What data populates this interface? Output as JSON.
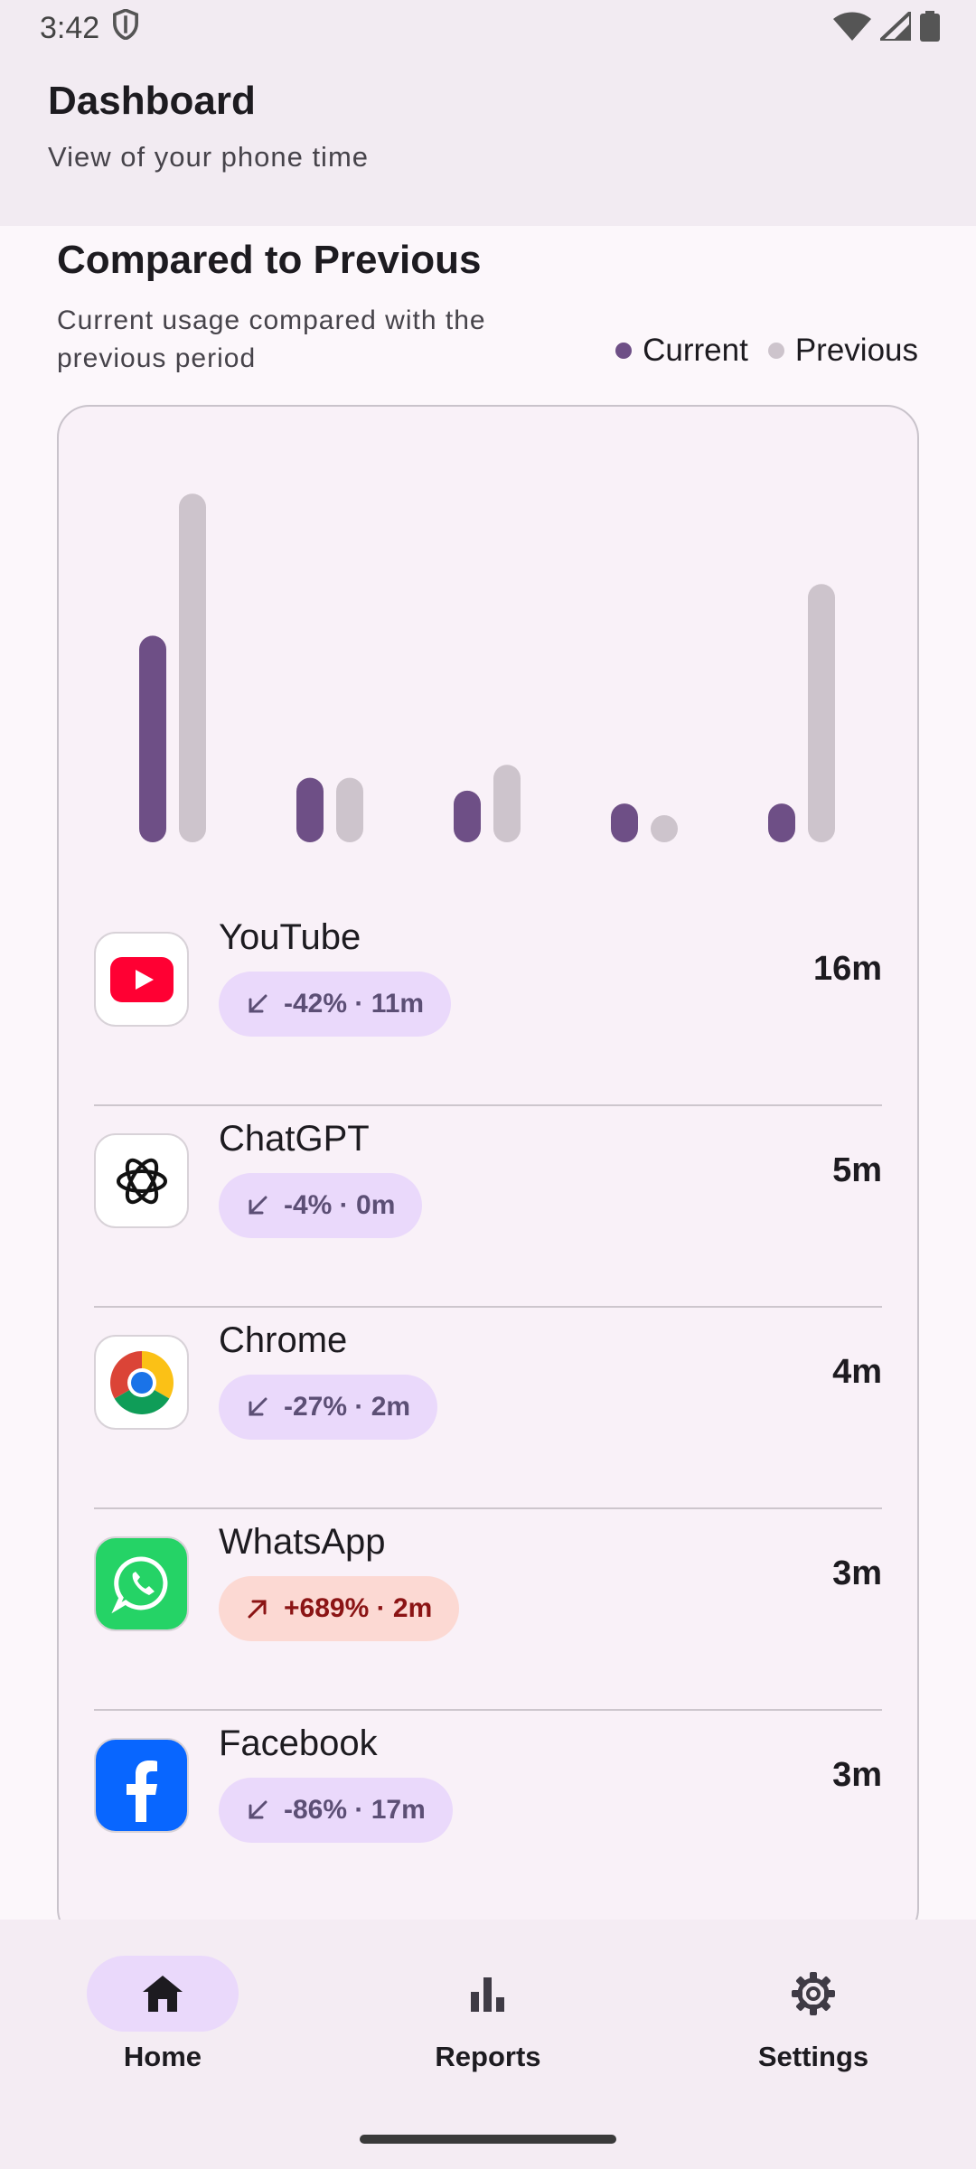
{
  "status_bar": {
    "time": "3:42",
    "icons": [
      "shield-icon",
      "wifi-icon",
      "signal-icon",
      "battery-icon"
    ]
  },
  "header": {
    "title": "Dashboard",
    "subtitle": "View of your phone time"
  },
  "section": {
    "title": "Compared to Previous",
    "description": "Current usage compared with the previous period",
    "legend": [
      {
        "label": "Current",
        "color": "#6e4f86"
      },
      {
        "label": "Previous",
        "color": "#cdc4cc"
      }
    ]
  },
  "chart_data": {
    "type": "bar",
    "categories": [
      "YouTube",
      "ChatGPT",
      "Chrome",
      "WhatsApp",
      "Facebook"
    ],
    "series": [
      {
        "name": "Current",
        "values": [
          16,
          5,
          4,
          3,
          3
        ],
        "color": "#6e4f86"
      },
      {
        "name": "Previous",
        "values": [
          27,
          5,
          6,
          1,
          20
        ],
        "color": "#cdc4cc"
      }
    ],
    "unit": "minutes",
    "ylim": [
      0,
      28
    ],
    "grid": false,
    "legend": "top-right"
  },
  "apps": [
    {
      "name": "YouTube",
      "icon": "youtube-icon",
      "change": "-42% · 11m",
      "direction": "down",
      "time": "16m"
    },
    {
      "name": "ChatGPT",
      "icon": "chatgpt-icon",
      "change": "-4% · 0m",
      "direction": "down",
      "time": "5m"
    },
    {
      "name": "Chrome",
      "icon": "chrome-icon",
      "change": "-27% · 2m",
      "direction": "down",
      "time": "4m"
    },
    {
      "name": "WhatsApp",
      "icon": "whatsapp-icon",
      "change": "+689% · 2m",
      "direction": "up",
      "time": "3m"
    },
    {
      "name": "Facebook",
      "icon": "facebook-icon",
      "change": "-86% · 17m",
      "direction": "down",
      "time": "3m"
    }
  ],
  "nav": {
    "items": [
      {
        "label": "Home",
        "icon": "home-icon",
        "active": true
      },
      {
        "label": "Reports",
        "icon": "bar-chart-icon",
        "active": false
      },
      {
        "label": "Settings",
        "icon": "gear-icon",
        "active": false
      }
    ]
  }
}
